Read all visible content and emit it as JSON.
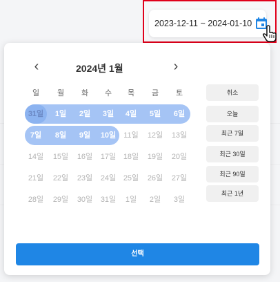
{
  "range_picker": {
    "value": "2023-12-11 ~ 2024-01-10",
    "accent_color": "#1f86e5",
    "icon": "calendar-icon",
    "cursor_icon": "hand-pointer-icon"
  },
  "calendar": {
    "month_title": "2024년 1월",
    "prev_icon": "chevron-left-icon",
    "next_icon": "chevron-right-icon",
    "weekdays": [
      "일",
      "월",
      "화",
      "수",
      "목",
      "금",
      "토"
    ],
    "weeks": [
      [
        "31일",
        "1일",
        "2일",
        "3일",
        "4일",
        "5일",
        "6일"
      ],
      [
        "7일",
        "8일",
        "9일",
        "10일",
        "11일",
        "12일",
        "13일"
      ],
      [
        "14일",
        "15일",
        "16일",
        "17일",
        "18일",
        "19일",
        "20일"
      ],
      [
        "21일",
        "22일",
        "23일",
        "24일",
        "25일",
        "26일",
        "27일"
      ],
      [
        "28일",
        "29일",
        "30일",
        "31일",
        "1일",
        "2일",
        "3일"
      ]
    ],
    "selected_range": "31일 ~ 10일",
    "selection_color": "#a5c4f5"
  },
  "presets": [
    "취소",
    "오늘",
    "최근 7일",
    "최근 30일",
    "최근 90일",
    "최근 1년"
  ],
  "actions": {
    "select_label": "선택"
  }
}
